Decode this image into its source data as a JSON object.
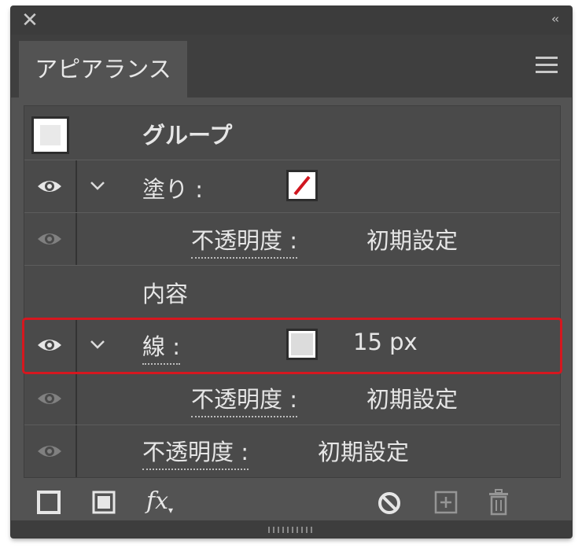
{
  "window": {
    "close_icon": "close-icon",
    "collapse_glyph": "‹‹"
  },
  "tab": {
    "label": "アピアランス"
  },
  "panel_menu_icon": "hamburger-menu-icon",
  "object": {
    "label": "グループ"
  },
  "fill": {
    "label": "塗り :",
    "swatch": "none"
  },
  "fill_opacity": {
    "label": "不透明度 :",
    "value": "初期設定"
  },
  "contents": {
    "label": "内容"
  },
  "stroke": {
    "label": "線 :",
    "weight": "15 px",
    "swatch_color": "#dcdcdc"
  },
  "stroke_opacity": {
    "label": "不透明度 :",
    "value": "初期設定"
  },
  "object_opacity": {
    "label": "不透明度 :",
    "value": "初期設定"
  },
  "toolbar": {
    "fx_label": "fx"
  },
  "colors": {
    "highlight": "#d6171f",
    "panel_bg": "#535353",
    "none_slash": "#d0161f"
  }
}
